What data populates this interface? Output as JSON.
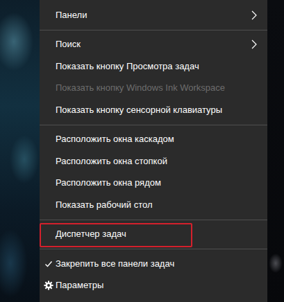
{
  "menu": {
    "items": [
      {
        "kind": "submenu",
        "label": "Панели",
        "disabled": false,
        "checked": false,
        "highlighted": false
      },
      {
        "kind": "separator"
      },
      {
        "kind": "submenu",
        "label": "Поиск",
        "disabled": false,
        "checked": false,
        "highlighted": false
      },
      {
        "kind": "command",
        "label": "Показать кнопку Просмотра задач",
        "disabled": false,
        "checked": false,
        "highlighted": false
      },
      {
        "kind": "command",
        "label": "Показать кнопку Windows Ink Workspace",
        "disabled": true,
        "checked": false,
        "highlighted": false
      },
      {
        "kind": "command",
        "label": "Показать кнопку сенсорной клавиатуры",
        "disabled": false,
        "checked": false,
        "highlighted": false
      },
      {
        "kind": "separator"
      },
      {
        "kind": "command",
        "label": "Расположить окна каскадом",
        "disabled": false,
        "checked": false,
        "highlighted": false
      },
      {
        "kind": "command",
        "label": "Расположить окна стопкой",
        "disabled": false,
        "checked": false,
        "highlighted": false
      },
      {
        "kind": "command",
        "label": "Расположить окна рядом",
        "disabled": false,
        "checked": false,
        "highlighted": false
      },
      {
        "kind": "command",
        "label": "Показать рабочий стол",
        "disabled": false,
        "checked": false,
        "highlighted": false
      },
      {
        "kind": "separator"
      },
      {
        "kind": "command",
        "label": "Диспетчер задач",
        "disabled": false,
        "checked": false,
        "highlighted": true
      },
      {
        "kind": "separator"
      },
      {
        "kind": "command",
        "label": "Закрепить все панели задач",
        "disabled": false,
        "checked": true,
        "highlighted": false
      },
      {
        "kind": "settings",
        "label": "Параметры",
        "disabled": false,
        "checked": false,
        "highlighted": false
      }
    ]
  }
}
